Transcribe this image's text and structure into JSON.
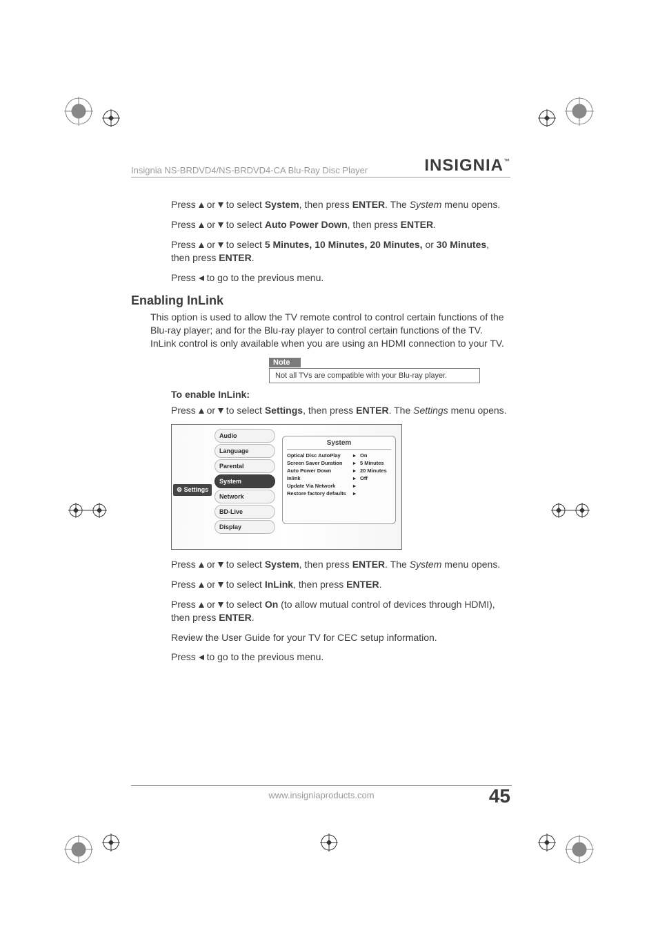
{
  "header": {
    "product_line": "Insignia NS-BRDVD4/NS-BRDVD4-CA Blu-Ray Disc Player",
    "brand": "INSIGNIA"
  },
  "instructions_a": [
    {
      "pre": "Press ",
      "mid": " or ",
      "post1": " to select ",
      "bold1": "System",
      "post2": ", then press ",
      "bold2": "ENTER",
      "post3": ". The ",
      "ital": "System",
      "post4": " menu opens."
    },
    {
      "pre": "Press ",
      "mid": " or ",
      "post1": " to select ",
      "bold1": "Auto Power Down",
      "post2": ", then press ",
      "bold2": "ENTER",
      "post3": "."
    },
    {
      "pre": "Press ",
      "mid": " or ",
      "post1": " to select ",
      "bold1": "5 Minutes, 10 Minutes, 20 Minutes,",
      "post2": " or ",
      "bold2": "30 Minutes",
      "post3": ", then press ",
      "bold3": "ENTER",
      "post4": "."
    },
    {
      "pre": "Press ",
      "post1": " to go to the previous menu."
    }
  ],
  "section_b": {
    "heading": "Enabling InLink",
    "desc": "This option is used to allow the TV remote control to control certain functions of the Blu-ray player; and for the Blu-ray player to control certain functions of the TV. InLink control is only available when you are using an HDMI connection to your TV.",
    "note_label": "Note",
    "note_body": "Not all TVs are compatible with your Blu-ray player.",
    "subheading": "To enable InLink:",
    "step1": {
      "pre": "Press ",
      "mid": " or ",
      "post1": " to select ",
      "bold1": "Settings",
      "post2": ", then press ",
      "bold2": "ENTER",
      "post3": ". The ",
      "ital": "Settings",
      "post4": " menu opens."
    }
  },
  "screenshot": {
    "left_tab_icon": "⚙",
    "left_tab": "Settings",
    "menu": [
      "Audio",
      "Language",
      "Parental",
      "System",
      "Network",
      "BD-Live",
      "Display"
    ],
    "selected_index": 3,
    "panel_title": "System",
    "panel_rows": [
      {
        "k": "Optical Disc AutoPlay",
        "v": "On"
      },
      {
        "k": "Screen Saver Duration",
        "v": "5 Minutes"
      },
      {
        "k": "Auto Power Down",
        "v": "20 Minutes"
      },
      {
        "k": "Inlink",
        "v": "Off"
      },
      {
        "k": "Update Via Network",
        "v": ""
      },
      {
        "k": "Restore factory defaults",
        "v": ""
      }
    ]
  },
  "instructions_c": [
    {
      "pre": "Press ",
      "mid": " or ",
      "post1": " to select ",
      "bold1": "System",
      "post2": ", then press ",
      "bold2": "ENTER",
      "post3": ". The ",
      "ital": "System",
      "post4": " menu opens."
    },
    {
      "pre": "Press ",
      "mid": " or ",
      "post1": " to select ",
      "bold1": "InLink",
      "post2": ", then press ",
      "bold2": "ENTER",
      "post3": "."
    },
    {
      "pre": "Press ",
      "mid": " or ",
      "post1": " to select ",
      "bold1": "On",
      "post2": " (to allow mutual control of devices through HDMI), then press ",
      "bold2": "ENTER",
      "post3": "."
    },
    {
      "text": "Review the User Guide for your TV for CEC setup information."
    },
    {
      "pre": "Press ",
      "post1": " to go to the previous menu."
    }
  ],
  "footer": {
    "url": "www.insigniaproducts.com",
    "page": "45"
  }
}
